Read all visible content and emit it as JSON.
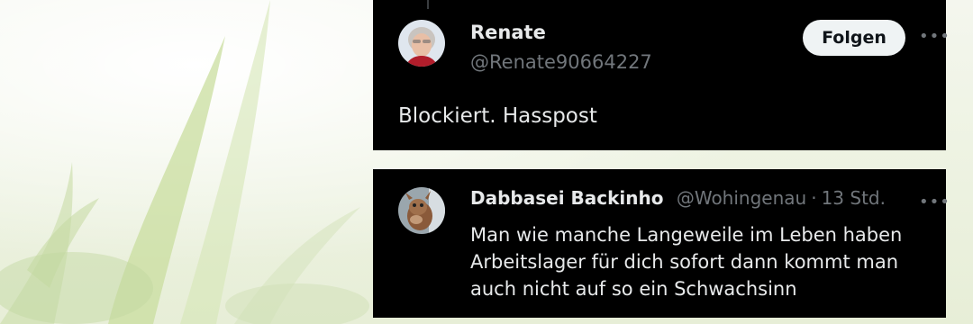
{
  "reply": {
    "display_name": "Renate",
    "handle": "@Renate90664227",
    "follow_label": "Folgen",
    "more_icon": "more-horizontal-icon",
    "text": "Blockiert. Hasspost"
  },
  "tweet": {
    "display_name": "Dabbasei Backinho",
    "handle": "@Wohingenau",
    "separator": "·",
    "timestamp": "13 Std.",
    "more_icon": "more-horizontal-icon",
    "text": "Man wie manche Langeweile im Leben haben Arbeitslager für dich sofort dann kommt man auch nicht auf so ein Schwachsinn"
  },
  "colors": {
    "card_bg": "#000000",
    "text_primary": "#e7e9ea",
    "text_secondary": "#71767b",
    "button_bg": "#eff3f4"
  }
}
